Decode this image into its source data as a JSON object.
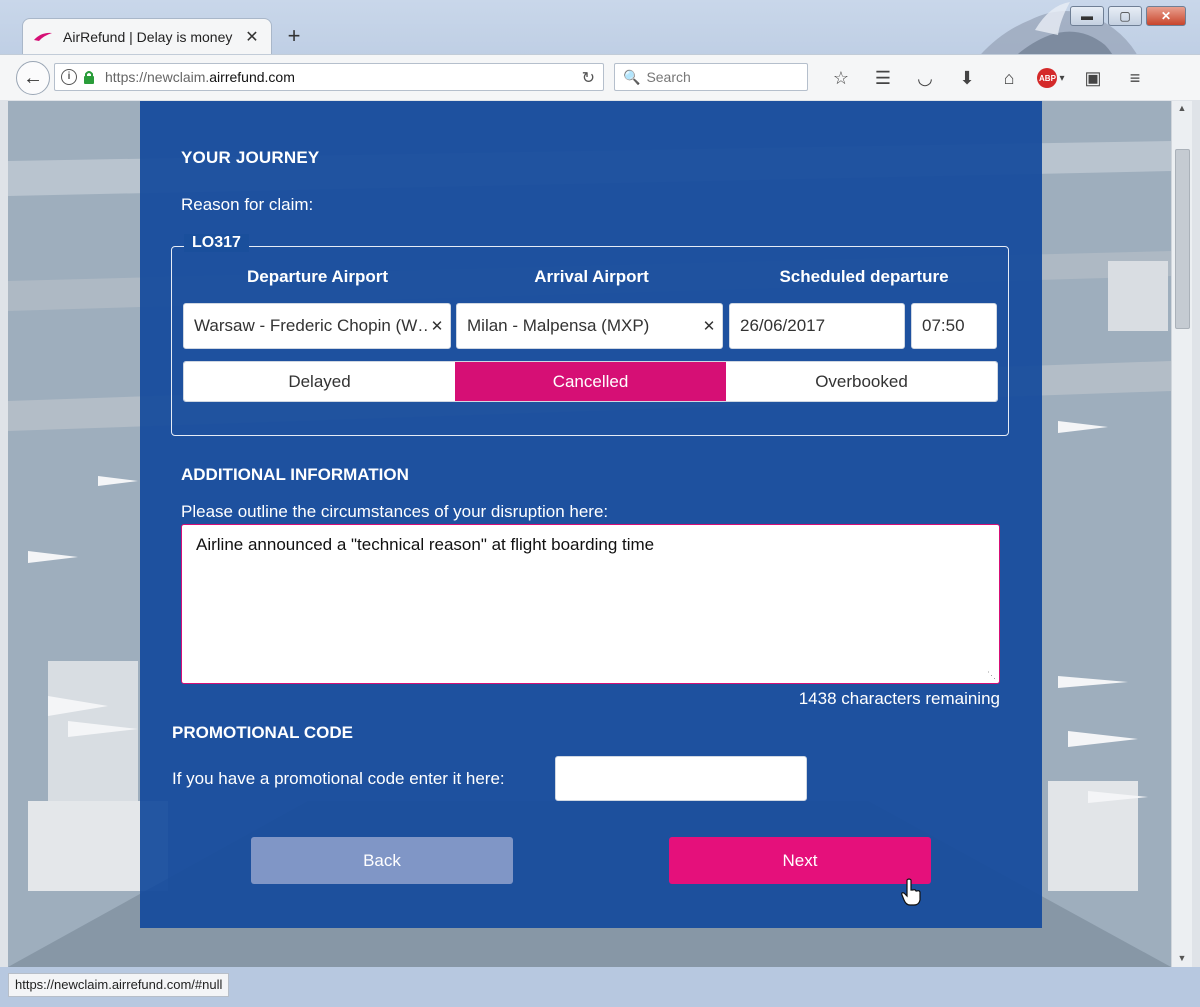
{
  "browser": {
    "tab_title": "AirRefund | Delay is money",
    "tab_close": "✕",
    "newtab": "+",
    "window_controls": {
      "minimize": "▬",
      "maximize": "▢",
      "close": "✕"
    },
    "url_prefix": "https://newclaim.",
    "url_host": "airrefund.com",
    "reload": "↻",
    "search_placeholder": "Search",
    "search_icon": "🔍",
    "info_icon": "i",
    "toolbar_icons": [
      "star",
      "reading-list",
      "pocket",
      "download",
      "home",
      "adblock-plus",
      "screenshot",
      "menu"
    ],
    "toolbar_glyphs": {
      "star": "☆",
      "reading_list": "☰",
      "pocket": "◡",
      "download": "⬇",
      "home": "⌂",
      "abp": "ABP",
      "dropdown": "▾",
      "screenshot": "▣",
      "menu": "≡"
    },
    "status_url": "https://newclaim.airrefund.com/#null"
  },
  "journey": {
    "heading": "YOUR JOURNEY",
    "reason_label": "Reason for claim:",
    "flight_number": "LO317",
    "columns": {
      "departure": "Departure Airport",
      "arrival": "Arrival Airport",
      "scheduled": "Scheduled departure"
    },
    "departure_value": "Warsaw - Frederic Chopin (WAW)",
    "departure_display": "Warsaw - Frederic Chopin (W…",
    "arrival_value": "Milan - Malpensa (MXP)",
    "clear_glyph": "✕",
    "date_value": "26/06/2017",
    "time_value": "07:50",
    "reasons": [
      "Delayed",
      "Cancelled",
      "Overbooked"
    ],
    "selected_reason": "Cancelled"
  },
  "additional": {
    "heading": "ADDITIONAL INFORMATION",
    "label": "Please outline the circumstances of your disruption here:",
    "text": "Airline announced a \"technical reason\" at flight boarding time",
    "remaining": "1438 characters remaining"
  },
  "promo": {
    "heading": "PROMOTIONAL CODE",
    "label": "If you have a promotional code enter it here:",
    "value": ""
  },
  "actions": {
    "back": "Back",
    "next": "Next"
  },
  "colors": {
    "panel": "#144A9C",
    "accent": "#D60F75",
    "back_button": "#8096C6"
  }
}
